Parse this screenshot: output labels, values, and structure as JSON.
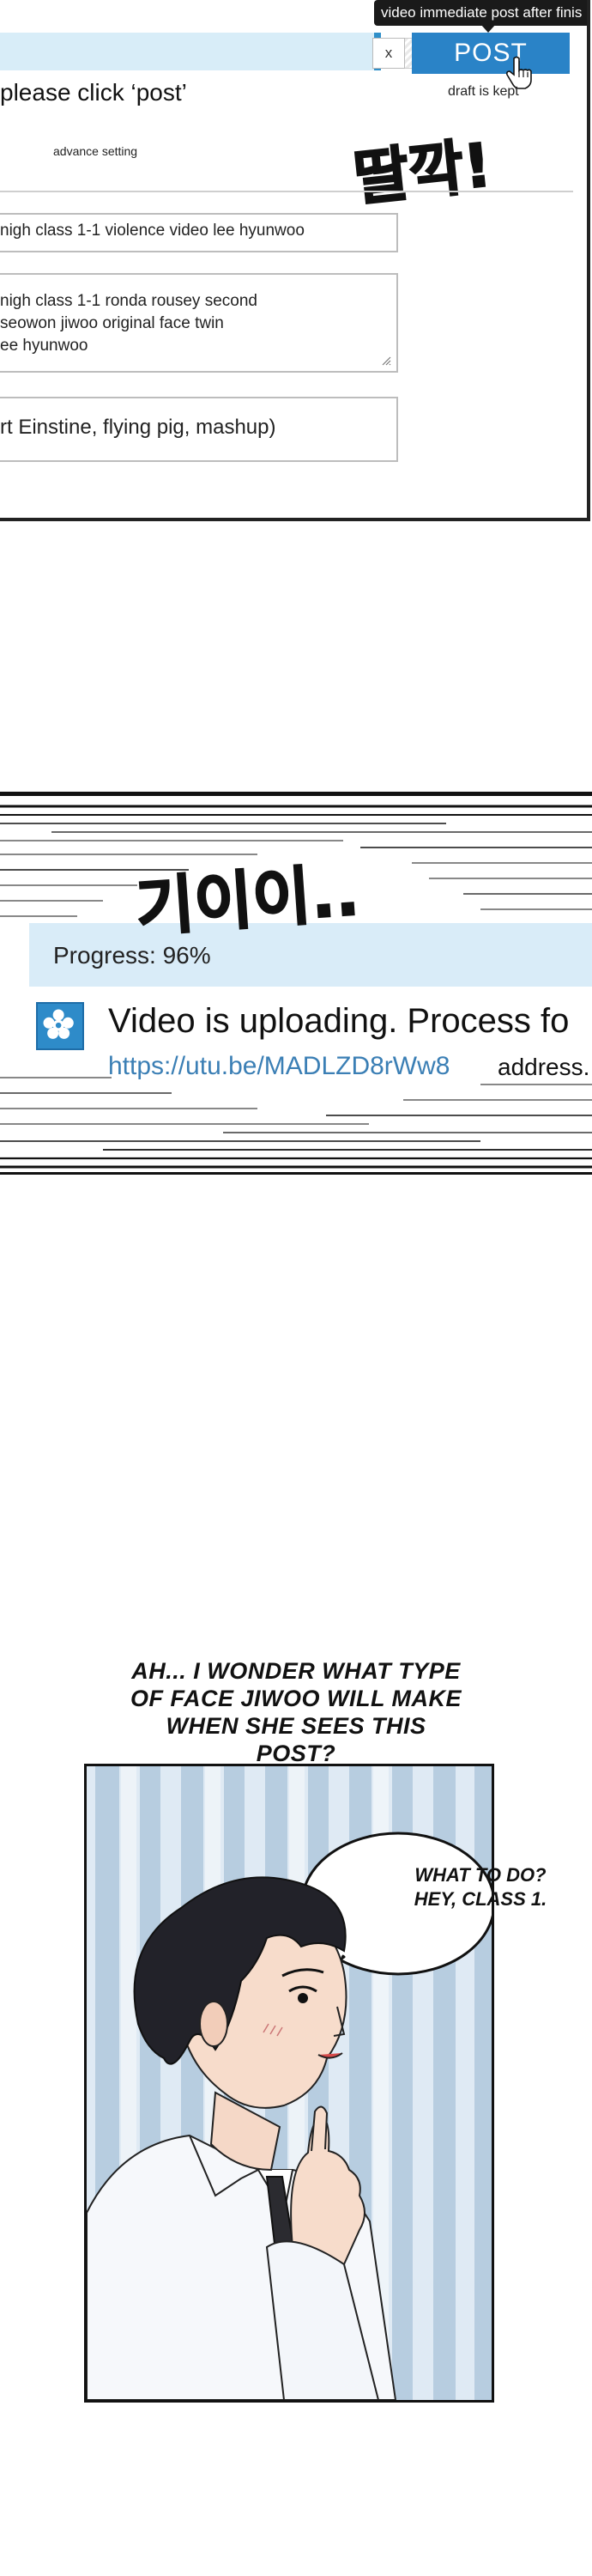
{
  "upload_form": {
    "tooltip": "video immediate post after finis",
    "post_label": "POST",
    "close_label": "x",
    "draft_note": "draft is kept",
    "instruction": "please click ‘post’",
    "advance_setting": "advance setting",
    "sfx": "딸깍!",
    "title_value": "nigh class 1-1 violence video lee hyunwoo",
    "description_lines": [
      "nigh class 1-1 ronda rousey second",
      "seowon jiwoo original face twin",
      "ee hyunwoo"
    ],
    "tags_value": "rt Einstine, flying pig, mashup)"
  },
  "upload_status": {
    "sfx": "기이이..",
    "progress_label": "Progress: 96%",
    "progress_percent": 96,
    "message": "Video is uploading. Process fo",
    "link": "https://utu.be/MADLZD8rWw8",
    "link_suffix": "address."
  },
  "comic": {
    "caption_lines": [
      "AH... I WONDER WHAT TYPE",
      "OF FACE JIWOO WILL MAKE",
      "WHEN SHE SEES THIS POST?"
    ],
    "bubble_lines": [
      "WHAT TO DO?",
      "HEY, CLASS 1."
    ]
  },
  "colors": {
    "accent_blue": "#2a83c7",
    "light_blue": "#d8edf8",
    "link_blue": "#3b7fb5"
  }
}
